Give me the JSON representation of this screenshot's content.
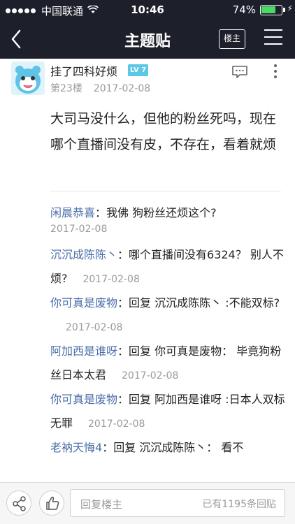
{
  "status_bar": {
    "carrier": "中国联通",
    "time": "10:46",
    "battery_text": "74%",
    "battery_level": 0.74,
    "battery_color": "#4cd964"
  },
  "nav": {
    "title": "主题贴",
    "owner_only_label": "楼主",
    "back_icon": "chevron-left-icon",
    "menu_icon": "hamburger-menu-icon"
  },
  "post": {
    "username": "挂了四科好烦",
    "level": "LV 7",
    "floor": "第23楼",
    "date": "2017-02-08",
    "content": "大司马没什么，但他的粉丝死吗，现在哪个直播间没有皮，不存在，看着就烦"
  },
  "replies": [
    {
      "name": "闲晨恭喜",
      "text": "：我佛 狗粉丝还烦这个?",
      "date": "2017-02-08"
    },
    {
      "name": "沉沉成陈陈丶",
      "text": "：哪个直播间没有6324？ 别人不烦?",
      "date": "2017-02-08"
    },
    {
      "name": "你可真是废物",
      "text": "：回复 沉沉成陈陈丶 :不能双标?",
      "date": "2017-02-08"
    },
    {
      "name": "阿加西是谁呀",
      "text": "：回复 你可真是废物： 毕竟狗粉丝日本太君",
      "date": "2017-02-08"
    },
    {
      "name": "你可真是废物",
      "text": "：回复 阿加西是谁呀 :日本人双标无罪",
      "date": "2017-02-08"
    },
    {
      "name": "老衲天悔4",
      "text": "：回复 沉沉成陈陈丶： 看不",
      "date": ""
    }
  ],
  "bottom_bar": {
    "reply_placeholder": "回复楼主",
    "reply_count": "已有1195条回贴"
  },
  "colors": {
    "header_bg": "#1d1f2b",
    "link": "#4a6ea9",
    "level_badge": "#5ac8e6"
  }
}
